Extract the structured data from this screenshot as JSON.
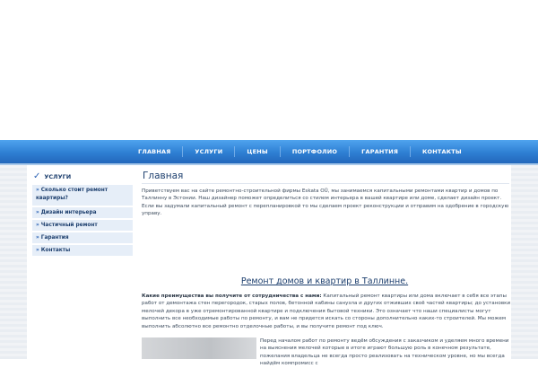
{
  "nav": {
    "items": [
      "ГЛАВНАЯ",
      "УСЛУГИ",
      "ЦЕНЫ",
      "ПОРТФОЛИО",
      "ГАРАНТИЯ",
      "КОНТАКТЫ"
    ]
  },
  "sidebar": {
    "title": "УСЛУГИ",
    "items": [
      "Сколько стоит ремонт квартиры?",
      "Дизайн интерьера",
      "Частичный ремонт",
      "Гарантия",
      "Контакты"
    ]
  },
  "main": {
    "title": "Главная",
    "intro": "Приветствуем вас на сайте ремонтно-строительной фирмы Eskata OÜ, мы занимаемся капитальными ремонтами квартир и домов по Таллинну в Эстонии. Наш дизайнер поможет определиться со стилем интерьера в вашей квартире или доме, сделает дизайн проект. Если вы задумали капитальный ремонт с перепланировкой то мы сделаем проект реконструкции и отправим на одобрение в городскую управу.",
    "subheading": "Ремонт домов и квартир в Таллинне.",
    "benefits_lead": "Какие преимущества вы получите от сотрудничества с нами:",
    "benefits_text": " Капитальный ремонт квартиры или дома включает в себя все этапы работ от демонтажа стен перегородок, старых полов, бетонной кабины санузла и других отживших своё частей квартиры; до установки мелочей декора в уже отремонтированной квартире и подключения бытовой техники. Это означает что наши специалисты могут выполнить все необходимые работы по ремонту, и вам не придется искать со стороны дополнительно каких-то строителей. Мы можем выполнить абсолютно все ремонтно отделочные работы, и вы получите ремонт под ключ.",
    "right_text": "Перед началом работ по ремонту ведём обсуждения с заказчиком и уделяем много времени на выяснения мелочей которые в итоге играют большую роль в конечном результате, пожелания владельца не всегда просто реализовать на техническом уровне, но мы всегда найдём компромисс с"
  }
}
